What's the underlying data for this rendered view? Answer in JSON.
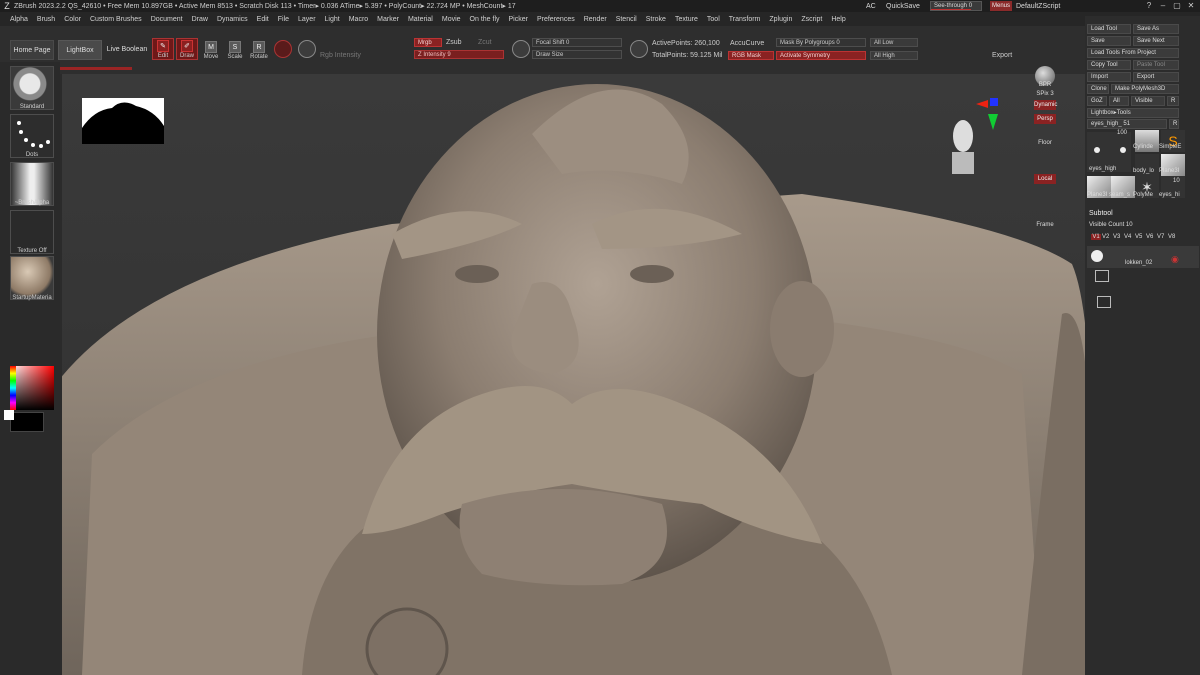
{
  "titlebar": {
    "title": "ZBrush 2023.2.2   QS_42610  • Free Mem 10.897GB • Active Mem 8513 • Scratch Disk 113 • Timer▸ 0.036 ATime▸ 5.397 • PolyCount▸ 22.724 MP • MeshCount▸ 17",
    "ac": "AC",
    "quicksave": "QuickSave",
    "seethrough": "See-through  0",
    "menus": "Menus",
    "default_zscript": "DefaultZScript"
  },
  "menu": [
    "Alpha",
    "Brush",
    "Color",
    "Custom Brushes",
    "Document",
    "Draw",
    "Dynamics",
    "Edit",
    "File",
    "Layer",
    "Light",
    "Macro",
    "Marker",
    "Material",
    "Movie",
    "On the fly",
    "Picker",
    "Preferences",
    "Render",
    "Stencil",
    "Stroke",
    "Texture",
    "Tool",
    "Transform",
    "Zplugin",
    "Zscript",
    "Help"
  ],
  "shelf": {
    "home": "Home Page",
    "lightbox": "LightBox",
    "live_boolean": "Live Boolean",
    "edit": "Edit",
    "draw": "Draw",
    "move": "Move",
    "scale": "Scale",
    "rotate": "Rotate",
    "rgb_intensity": "Rgb Intensity",
    "mrgb": "Mrgb",
    "zsub": "Zsub",
    "zcut": "Zcut",
    "z_intensity": "Z Intensity 9",
    "focal_shift": "Focal Shift 0",
    "draw_size": "Draw Size",
    "active_points": "ActivePoints: 260,100",
    "total_points": "TotalPoints: 59.125 Mil",
    "accucurve": "AccuCurve",
    "mask_by_polygroups": "Mask By Polygroups 0",
    "all_low": "All Low",
    "all_high": "All High",
    "rgb_mask": "RGB Mask",
    "activate_symmetry": "Activate Symmetry",
    "export": "Export"
  },
  "lefttray": {
    "standard": "Standard",
    "dots": "Dots",
    "brushalpha": "~BrushAlpha",
    "texture_off": "Texture Off",
    "startup_material": "StartupMateria"
  },
  "rstrip": {
    "bpr": "BPR",
    "spix": "SPix 3",
    "dynamic": "Dynamic",
    "persp": "Persp",
    "floor": "Floor",
    "local": "Local",
    "frame": "Frame"
  },
  "rpanel": {
    "load_tool": "Load Tool",
    "save_as": "Save As",
    "save": "Save",
    "save_next": "Save Next",
    "load_tools_from_project": "Load Tools From Project",
    "copy_tool": "Copy Tool",
    "paste_tool": "Paste Tool",
    "import": "Import",
    "export": "Export",
    "clone": "Clone",
    "make_polymesh3d": "Make PolyMesh3D",
    "goz": "GoZ",
    "all": "All",
    "visible": "Visible",
    "r": "R",
    "lightbox_tools": "Lightbox▸Tools",
    "current_tool": "eyes_high_ 51",
    "thumb_count": "100",
    "thumbs": [
      "eyes_high",
      "Cylinde",
      "SimpleE",
      "body_lo",
      "Plane3I",
      "Plane3I",
      "seam_s",
      "PolyMe",
      "eyes_hi"
    ],
    "thumb_count2": "10",
    "subtool": "Subtool",
    "visible_count": "Visible Count 10",
    "levels": [
      "V1",
      "V2",
      "V3",
      "V4",
      "V5",
      "V6",
      "V7",
      "V8"
    ],
    "subtool_name": "lokken_02"
  },
  "colors": {
    "accent_red": "#8a2222",
    "sculpt": "#8b7d70",
    "background": "#2b2b2b"
  }
}
